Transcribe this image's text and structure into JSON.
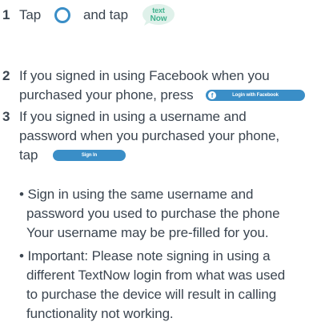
{
  "steps": [
    {
      "number": "1",
      "text_a": "Tap",
      "text_b": "and tap",
      "home_icon": "circle-home-button-icon",
      "logo_text": "TextNow"
    },
    {
      "number": "2",
      "line1": "If you signed in using Facebook when you",
      "line2": "purchased your phone, press",
      "button_label": "Login with Facebook",
      "button_icon_glyph": "f"
    },
    {
      "number": "3",
      "line1": "If you signed in using a username and",
      "line2": "password when you purchased your phone,",
      "line3": "tap",
      "button_label": "Sign In"
    }
  ],
  "bullets": [
    {
      "lines": [
        "• Sign in using the same username and",
        "password you used to purchase the phone",
        "Your username may be pre-filled for you."
      ]
    },
    {
      "lines": [
        "• Important: Please note signing in using a",
        "different TextNow login from what was used",
        "to purchase the device will result in calling",
        "functionality not working."
      ]
    }
  ],
  "colors": {
    "text": "#3b4550",
    "accent": "#3a8ec7"
  }
}
